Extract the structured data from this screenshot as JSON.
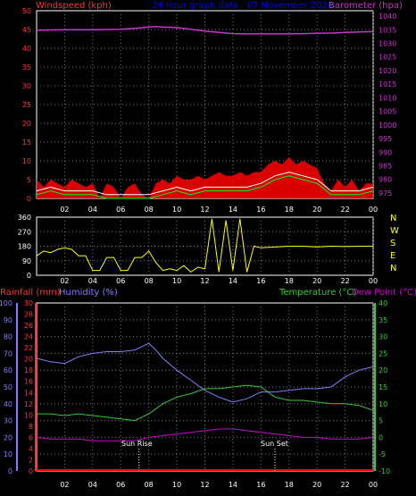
{
  "header": {
    "left": "Windspeed (kph)",
    "center": "24 hour graph data : 07 November 2024",
    "right": "Barometer (hpa)"
  },
  "colors": {
    "wind": "#ff0000",
    "gust": "#ffffff",
    "avg": "#00ff00",
    "baro": "#cc33cc",
    "dir": "#ffff00",
    "rain": "#ff0000",
    "hum": "#7f7fff",
    "temp": "#33cc33",
    "dew": "#cc00cc",
    "axisText": "#ff3333",
    "title": "#0000ff"
  },
  "chart_data": [
    {
      "type": "line",
      "title": "24 hour graph data : 07 November 2024",
      "ylabel_left": "Windspeed (kph)",
      "ylabel_right": "Barometer (hpa)",
      "x_ticks": [
        "02",
        "04",
        "06",
        "08",
        "10",
        "12",
        "14",
        "16",
        "18",
        "20",
        "22",
        "00"
      ],
      "y_left_ticks": [
        0,
        5,
        10,
        15,
        20,
        25,
        30,
        35,
        40,
        45,
        50
      ],
      "y_right_ticks": [
        975,
        980,
        985,
        990,
        995,
        1000,
        1005,
        1010,
        1015,
        1020,
        1025,
        1030,
        1035,
        1040
      ],
      "ylim_left": [
        0,
        50
      ],
      "ylim_right": [
        973,
        1042
      ],
      "grid": true,
      "series": [
        {
          "key": "baro",
          "x": [
            0,
            2,
            4,
            6,
            7,
            8,
            8.5,
            9,
            10,
            11,
            12,
            13,
            14,
            15,
            16,
            17,
            18,
            19,
            20,
            21,
            22,
            23,
            24
          ],
          "values": [
            1034.8,
            1035,
            1035,
            1035.2,
            1035.5,
            1036,
            1036.2,
            1036,
            1035.8,
            1035.2,
            1034.5,
            1034,
            1033.6,
            1033.5,
            1033.5,
            1033.5,
            1033.5,
            1033.6,
            1033.7,
            1033.8,
            1034,
            1034.2,
            1034.3
          ]
        },
        {
          "key": "wind",
          "x": [
            0,
            0.5,
            1,
            1.5,
            2,
            2.5,
            3,
            3.5,
            4,
            4.5,
            5,
            5.5,
            6,
            6.5,
            7,
            7.5,
            8,
            8.5,
            9,
            9.5,
            10,
            10.5,
            11,
            11.5,
            12,
            12.5,
            13,
            13.5,
            14,
            14.5,
            15,
            15.5,
            16,
            16.5,
            17,
            17.5,
            18,
            18.5,
            19,
            19.5,
            20,
            20.5,
            21,
            21.5,
            22,
            22.5,
            23,
            23.5,
            24
          ],
          "values": [
            5,
            3,
            5,
            4,
            3,
            5,
            4,
            3,
            4,
            0,
            4,
            3,
            0,
            3,
            4,
            1,
            0,
            4,
            5,
            4,
            6,
            5,
            5,
            6,
            5,
            6,
            7,
            6,
            6,
            7,
            6,
            7,
            7,
            9,
            10,
            9,
            11,
            9,
            10,
            9,
            8,
            4,
            2,
            5,
            3,
            5,
            2,
            4,
            4
          ]
        },
        {
          "key": "gust",
          "x": [
            0,
            1,
            2,
            3,
            4,
            5,
            6,
            7,
            8,
            9,
            10,
            11,
            12,
            13,
            14,
            15,
            16,
            17,
            18,
            19,
            20,
            21,
            22,
            23,
            24
          ],
          "values": [
            2,
            3,
            2,
            2,
            2,
            1,
            1,
            1,
            1,
            2,
            3,
            2,
            3,
            3,
            3,
            3,
            4,
            6,
            7,
            6,
            5,
            2,
            2,
            2,
            3
          ]
        }
      ]
    },
    {
      "type": "line",
      "title": "",
      "y_ticks": [
        0,
        90,
        180,
        270,
        360
      ],
      "right_labels": [
        "N",
        "W",
        "S",
        "E",
        "N"
      ],
      "ylim": [
        0,
        360
      ],
      "series": [
        {
          "key": "dir",
          "x": [
            0,
            0.5,
            1,
            1.5,
            2,
            2.5,
            3,
            3.5,
            4,
            4.5,
            5,
            5.5,
            6,
            6.5,
            7,
            7.5,
            8,
            8.5,
            9,
            9.5,
            10,
            10.5,
            11,
            11.5,
            12,
            12.5,
            13,
            13.5,
            14,
            14.5,
            15,
            15.5,
            16,
            17,
            18,
            19,
            20,
            21,
            22,
            23,
            24
          ],
          "values": [
            120,
            150,
            140,
            160,
            170,
            160,
            120,
            120,
            30,
            30,
            110,
            110,
            30,
            30,
            110,
            110,
            150,
            80,
            30,
            40,
            30,
            60,
            20,
            50,
            40,
            350,
            20,
            340,
            30,
            350,
            20,
            180,
            170,
            175,
            180,
            180,
            175,
            180,
            178,
            180,
            180
          ]
        }
      ]
    },
    {
      "type": "line",
      "title": "",
      "ylabel_left_1": "Rainfall (mm)",
      "ylabel_left_2": "Humidity (%)",
      "ylabel_right_1": "Temperature (°C)",
      "ylabel_right_2": "Dew Point (°C)",
      "x_ticks": [
        "02",
        "04",
        "06",
        "08",
        "10",
        "12",
        "14",
        "16",
        "18",
        "20",
        "22",
        "00"
      ],
      "humidity_ticks": [
        0,
        10,
        20,
        30,
        40,
        50,
        60,
        70,
        80,
        90,
        100
      ],
      "rain_ticks": [
        0,
        2,
        4,
        6,
        8,
        10,
        12,
        14,
        16,
        18,
        20,
        22,
        24,
        26,
        28,
        30
      ],
      "temp_ticks": [
        -10,
        -5,
        0,
        5,
        10,
        15,
        20,
        25,
        30,
        35,
        40
      ],
      "annotations": [
        {
          "text": "Sun Rise",
          "x": 7.3
        },
        {
          "text": "Sun Set",
          "x": 17
        }
      ],
      "series": [
        {
          "key": "hum",
          "x": [
            0,
            1,
            2,
            3,
            4,
            5,
            6,
            7,
            8,
            8.5,
            9,
            10,
            11,
            12,
            13,
            14,
            15,
            16,
            17,
            18,
            19,
            20,
            21,
            22,
            23,
            24
          ],
          "values": [
            67,
            65,
            64,
            68,
            70,
            71,
            71,
            72,
            76,
            72,
            67,
            60,
            54,
            48,
            44,
            41,
            43,
            47,
            47,
            48,
            49,
            49,
            50,
            56,
            60,
            62
          ]
        },
        {
          "key": "temp",
          "x": [
            0,
            1,
            2,
            3,
            4,
            5,
            6,
            7,
            8,
            9,
            10,
            11,
            12,
            13,
            14,
            15,
            16,
            17,
            18,
            19,
            20,
            21,
            22,
            23,
            24
          ],
          "values": [
            7,
            7,
            6.5,
            7,
            6.5,
            6,
            5.5,
            5,
            7,
            10,
            12,
            13,
            14.5,
            14.5,
            15,
            15.5,
            15,
            12,
            11,
            11,
            10.5,
            10,
            10,
            9.5,
            8
          ]
        },
        {
          "key": "dew",
          "x": [
            0,
            1,
            2,
            3,
            4,
            5,
            6,
            7,
            8,
            9,
            10,
            11,
            12,
            13,
            14,
            15,
            16,
            17,
            18,
            19,
            20,
            21,
            22,
            23,
            24
          ],
          "values": [
            0,
            -0.5,
            -0.5,
            -0.5,
            -1,
            -1,
            -1,
            -1,
            0,
            0.5,
            1,
            1.5,
            2,
            2.5,
            2.5,
            2,
            1.5,
            1,
            0.5,
            0,
            0,
            -0.5,
            -0.5,
            -0.5,
            0
          ]
        },
        {
          "key": "rain",
          "x": [
            0,
            24
          ],
          "values": [
            0,
            0
          ]
        }
      ]
    }
  ]
}
